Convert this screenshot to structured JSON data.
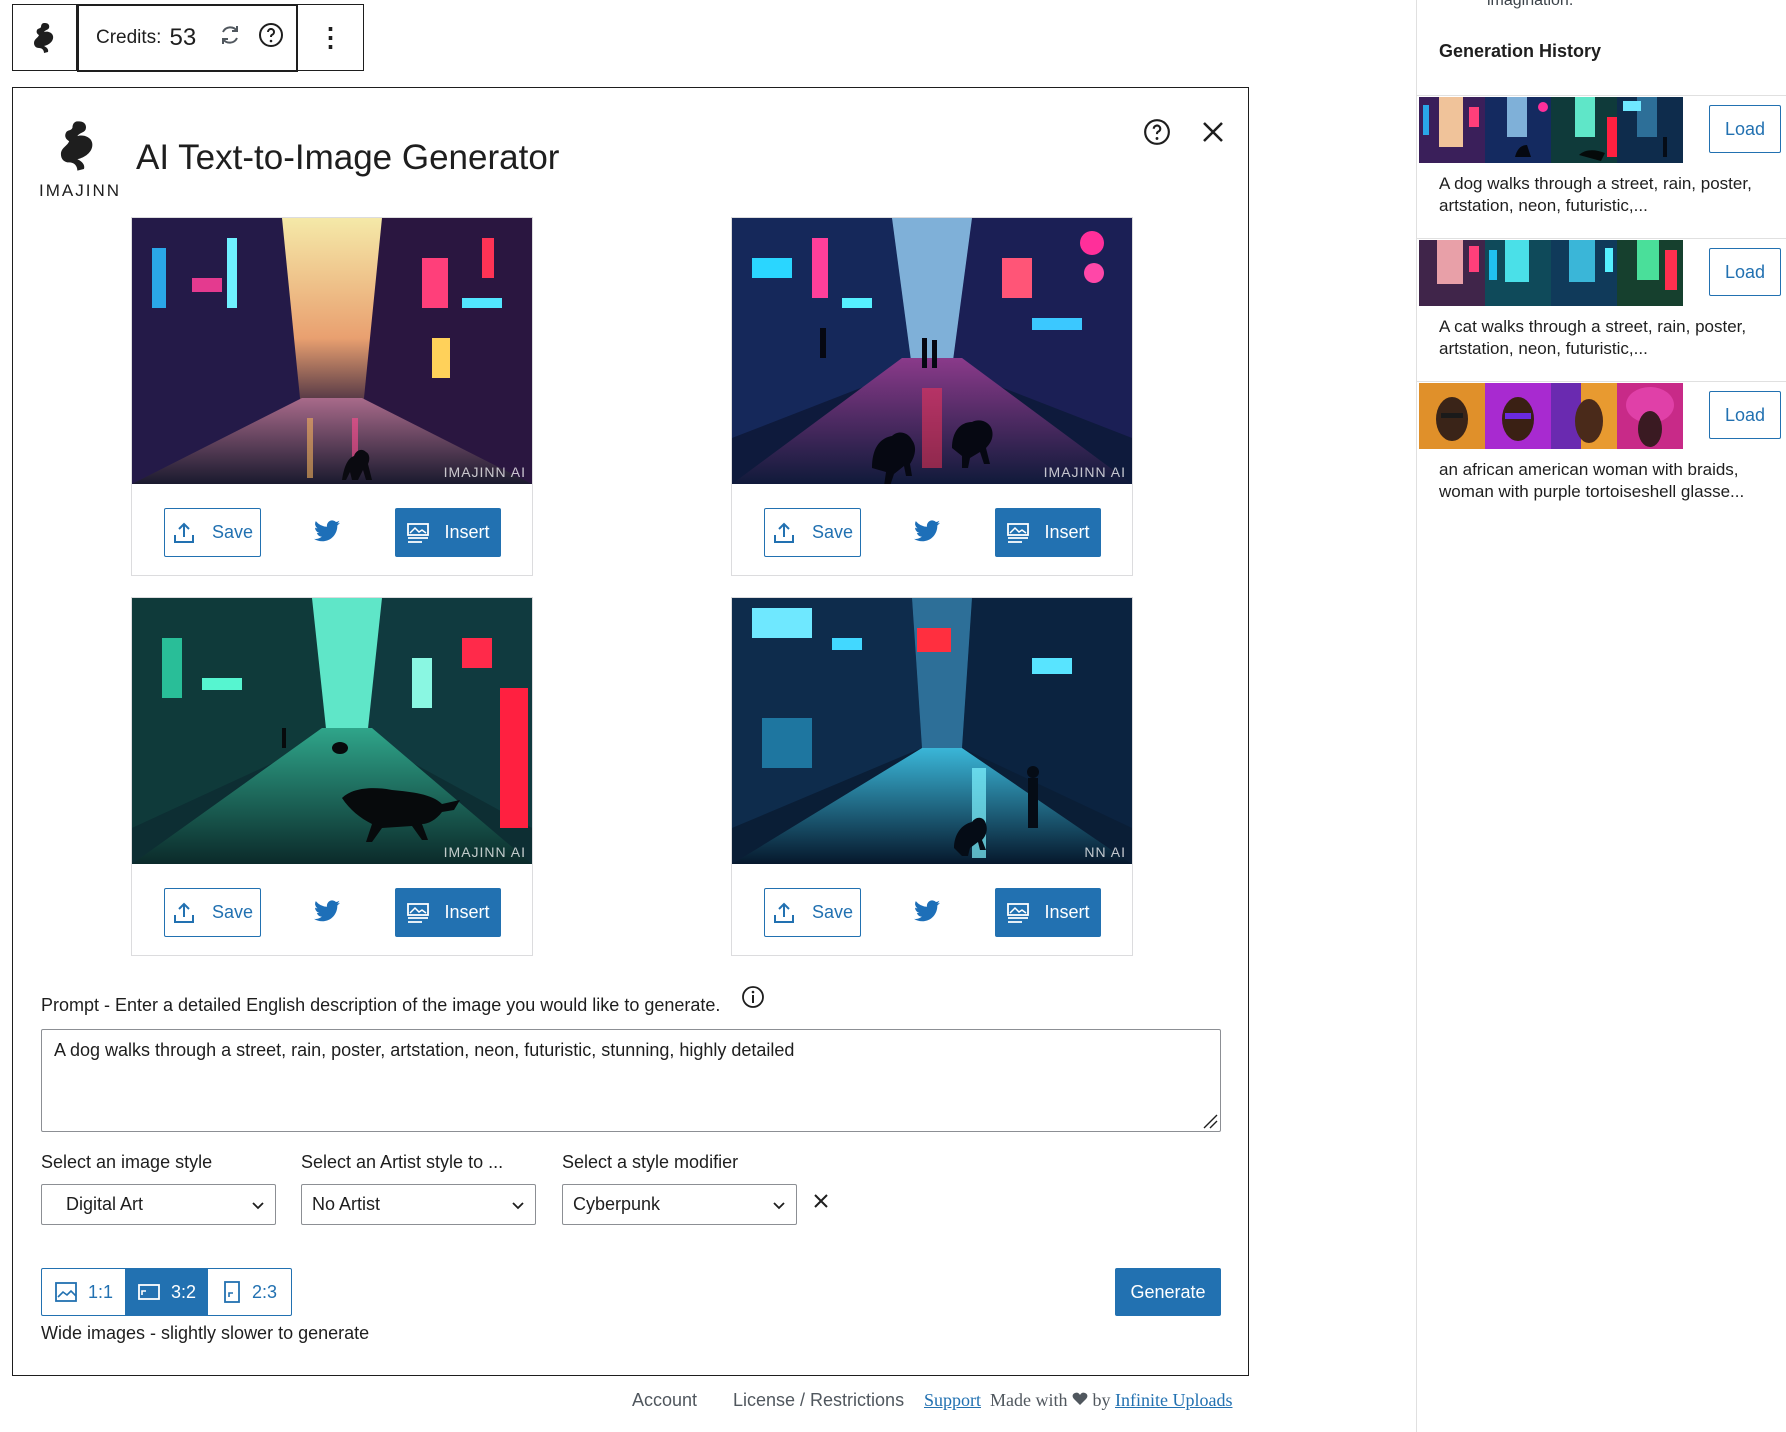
{
  "toolbar": {
    "credits_label": "Credits:",
    "credits_value": "53"
  },
  "modal": {
    "title": "AI Text-to-Image Generator",
    "brand": "IMAJINN"
  },
  "cards": [
    {
      "watermark": "IMAJINN AI",
      "save_label": "Save",
      "insert_label": "Insert"
    },
    {
      "watermark": "IMAJINN AI",
      "save_label": "Save",
      "insert_label": "Insert"
    },
    {
      "watermark": "IMAJINN AI",
      "save_label": "Save",
      "insert_label": "Insert"
    },
    {
      "watermark": "NN AI",
      "save_label": "Save",
      "insert_label": "Insert"
    }
  ],
  "prompt": {
    "label": "Prompt - Enter a detailed English description of the image you would like to generate.",
    "value": "A dog walks through a street, rain, poster, artstation, neon, futuristic, stunning, highly detailed"
  },
  "selects": {
    "image_style": {
      "label": "Select an image style",
      "value": "Digital Art"
    },
    "artist_style": {
      "label": "Select an Artist style to ...",
      "value": "No Artist"
    },
    "style_modifier": {
      "label": "Select a style modifier",
      "value": "Cyberpunk"
    }
  },
  "ratios": [
    {
      "label": "1:1",
      "active": false
    },
    {
      "label": "3:2",
      "active": true
    },
    {
      "label": "2:3",
      "active": false
    }
  ],
  "ratio_note": "Wide images - slightly slower to generate",
  "generate_label": "Generate",
  "footer": {
    "account": "Account",
    "license": "License / Restrictions",
    "support": "Support",
    "made_with": "Made with",
    "by": "by",
    "infinite": "Infinite Uploads"
  },
  "sidebar": {
    "cut_text": "imagination.",
    "title": "Generation History",
    "items": [
      {
        "load_label": "Load",
        "text": "A dog walks through a street, rain, poster, artstation, neon, futuristic,..."
      },
      {
        "load_label": "Load",
        "text": "A cat walks through a street, rain, poster, artstation, neon, futuristic,..."
      },
      {
        "load_label": "Load",
        "text": "an african american woman with braids, woman with purple tortoiseshell glasse..."
      }
    ]
  },
  "colors": {
    "accent": "#2271b1",
    "border": "#1e1e1e",
    "twitter": "#1d6fb8"
  }
}
